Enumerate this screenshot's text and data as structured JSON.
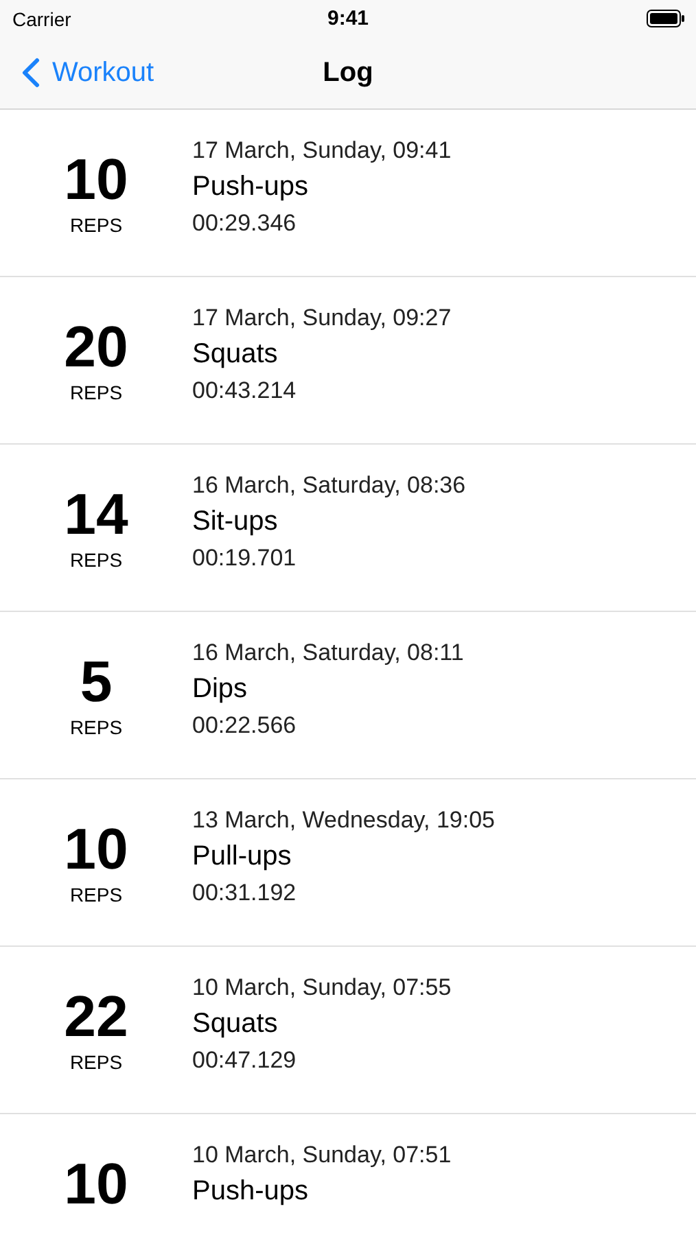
{
  "status_bar": {
    "carrier": "Carrier",
    "time": "9:41"
  },
  "nav_bar": {
    "back_label": "Workout",
    "title": "Log"
  },
  "entries": [
    {
      "count": "10",
      "unit": "REPS",
      "date": "17 March, Sunday, 09:41",
      "exercise": "Push-ups",
      "duration": "00:29.346"
    },
    {
      "count": "20",
      "unit": "REPS",
      "date": "17 March, Sunday, 09:27",
      "exercise": "Squats",
      "duration": "00:43.214"
    },
    {
      "count": "14",
      "unit": "REPS",
      "date": "16 March, Saturday, 08:36",
      "exercise": "Sit-ups",
      "duration": "00:19.701"
    },
    {
      "count": "5",
      "unit": "REPS",
      "date": "16 March, Saturday, 08:11",
      "exercise": "Dips",
      "duration": "00:22.566"
    },
    {
      "count": "10",
      "unit": "REPS",
      "date": "13 March, Wednesday, 19:05",
      "exercise": "Pull-ups",
      "duration": "00:31.192"
    },
    {
      "count": "22",
      "unit": "REPS",
      "date": "10 March, Sunday, 07:55",
      "exercise": "Squats",
      "duration": "00:47.129"
    },
    {
      "count": "10",
      "date": "10 March, Sunday, 07:51",
      "exercise": "Push-ups"
    }
  ]
}
